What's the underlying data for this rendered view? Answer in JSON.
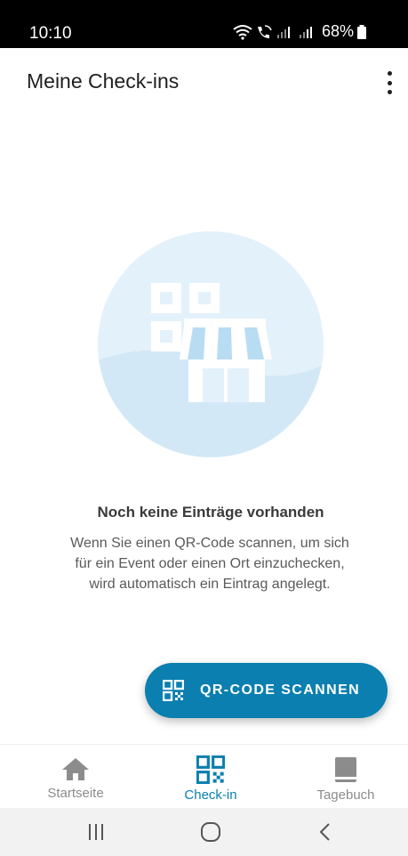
{
  "status_bar": {
    "time": "10:10",
    "battery": "68%"
  },
  "app_bar": {
    "title": "Meine Check-ins",
    "menu_icon": "more-vert-icon"
  },
  "empty_state": {
    "illustration_icon": "storefront-qr-illustration",
    "title": "Noch keine Einträge vorhanden",
    "description": "Wenn Sie einen QR-Code scannen, um sich für ein Event oder einen Ort einzuchecken, wird automatisch ein Eintrag angelegt."
  },
  "fab": {
    "label": "QR-CODE SCANNEN",
    "icon": "qr-code-icon",
    "color": "#0a7fb0"
  },
  "bottom_nav": {
    "active": "Check-in",
    "items": [
      {
        "label": "Startseite",
        "icon": "home-icon"
      },
      {
        "label": "Check-in",
        "icon": "qr-code-icon"
      },
      {
        "label": "Tagebuch",
        "icon": "book-icon"
      }
    ]
  },
  "colors": {
    "accent": "#0a7fb0",
    "inactive": "#8c8c8c",
    "illustration_bg": "#e3f1fb"
  }
}
